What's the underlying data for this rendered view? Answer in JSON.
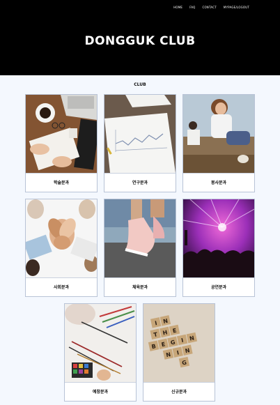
{
  "nav": {
    "items": [
      "HOME",
      "FAQ",
      "CONTACT",
      "MYPAGE/LOGOUT"
    ]
  },
  "hero": {
    "title": "DONGGUK CLUB"
  },
  "section": {
    "title": "CLUB"
  },
  "cards": [
    {
      "label": "학술분과",
      "image": "study-desk-photo"
    },
    {
      "label": "연구분과",
      "image": "research-chart-photo"
    },
    {
      "label": "봉사분과",
      "image": "volunteer-photo"
    },
    {
      "label": "사회분과",
      "image": "social-hands-photo"
    },
    {
      "label": "체육분과",
      "image": "running-shoes-photo"
    },
    {
      "label": "공연분과",
      "image": "concert-photo"
    },
    {
      "label": "예창분과",
      "image": "art-brushes-photo"
    },
    {
      "label": "신규분과",
      "image": "scrabble-beginning-photo"
    }
  ],
  "scrabble_tiles": [
    "I",
    "N",
    "T",
    "H",
    "E",
    "B",
    "E",
    "G",
    "I",
    "N",
    "N",
    "I",
    "N",
    "G"
  ]
}
